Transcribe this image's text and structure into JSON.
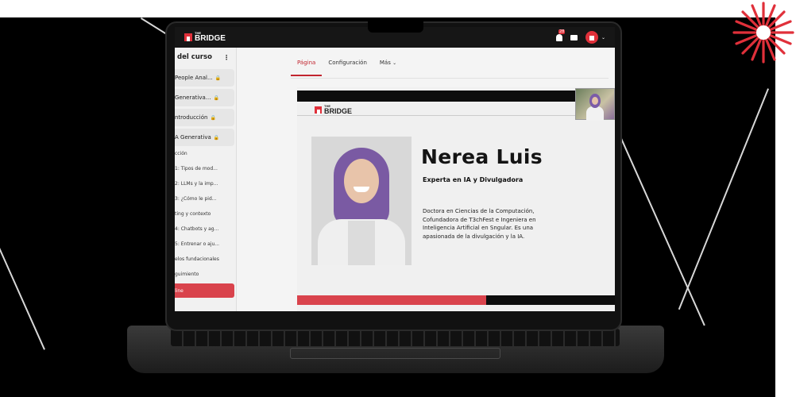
{
  "brand": {
    "logo_small": "THE",
    "logo_big": "BRIDGE",
    "accent": "#e0303a"
  },
  "topbar": {
    "notification_count": "28",
    "chevron": "⌄"
  },
  "sidebar": {
    "title": "del curso",
    "menu_icon": "⋮",
    "modules": [
      {
        "label": "People Anal..."
      },
      {
        "label": "Generativa..."
      },
      {
        "label": "ntroducción"
      },
      {
        "label": "A Generativa"
      }
    ],
    "items": [
      "cción",
      "1: Tipos de mod...",
      "2: LLMs y la imp...",
      "3: ¿Cómo le pid...",
      "ting y contexto",
      "4: Chatbots y ag...",
      "5: Entrenar o aju...",
      "elos fundacionales",
      "guimiento"
    ],
    "active_item": "line"
  },
  "tabs": {
    "page": "Página",
    "config": "Configuración",
    "more": "Más"
  },
  "slide": {
    "logo_small": "THE",
    "logo_big": "BRIDGE",
    "name": "Nerea Luis",
    "role": "Experta en IA y Divulgadora",
    "bio": "Doctora en Ciencias de la Computación, Cofundadora de T3chFest e Ingeniera en Inteligencia Artificial en Sngular. Es una apasionada de la divulgación y la IA."
  }
}
